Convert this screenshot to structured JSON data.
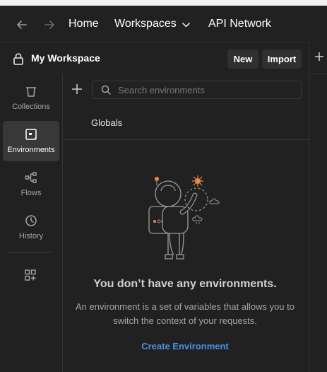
{
  "nav": {
    "home": "Home",
    "workspaces": "Workspaces",
    "api_network": "API Network"
  },
  "workspace": {
    "title": "My Workspace",
    "new_label": "New",
    "import_label": "Import"
  },
  "sidebar": {
    "items": [
      {
        "label": "Collections",
        "icon": "trash-bin-icon"
      },
      {
        "label": "Environments",
        "icon": "environment-icon",
        "active": true
      },
      {
        "label": "Flows",
        "icon": "flows-icon"
      },
      {
        "label": "History",
        "icon": "history-icon"
      }
    ]
  },
  "search": {
    "placeholder": "Search environments"
  },
  "globals_label": "Globals",
  "empty_state": {
    "title": "You don’t have any environments.",
    "description": "An environment is a set of variables that allows you to switch the context of your requests.",
    "action": "Create Environment"
  },
  "colors": {
    "accent_link": "#4a90e2",
    "background": "#212121",
    "active_item": "#383838",
    "art_orange": "#e8894a"
  }
}
